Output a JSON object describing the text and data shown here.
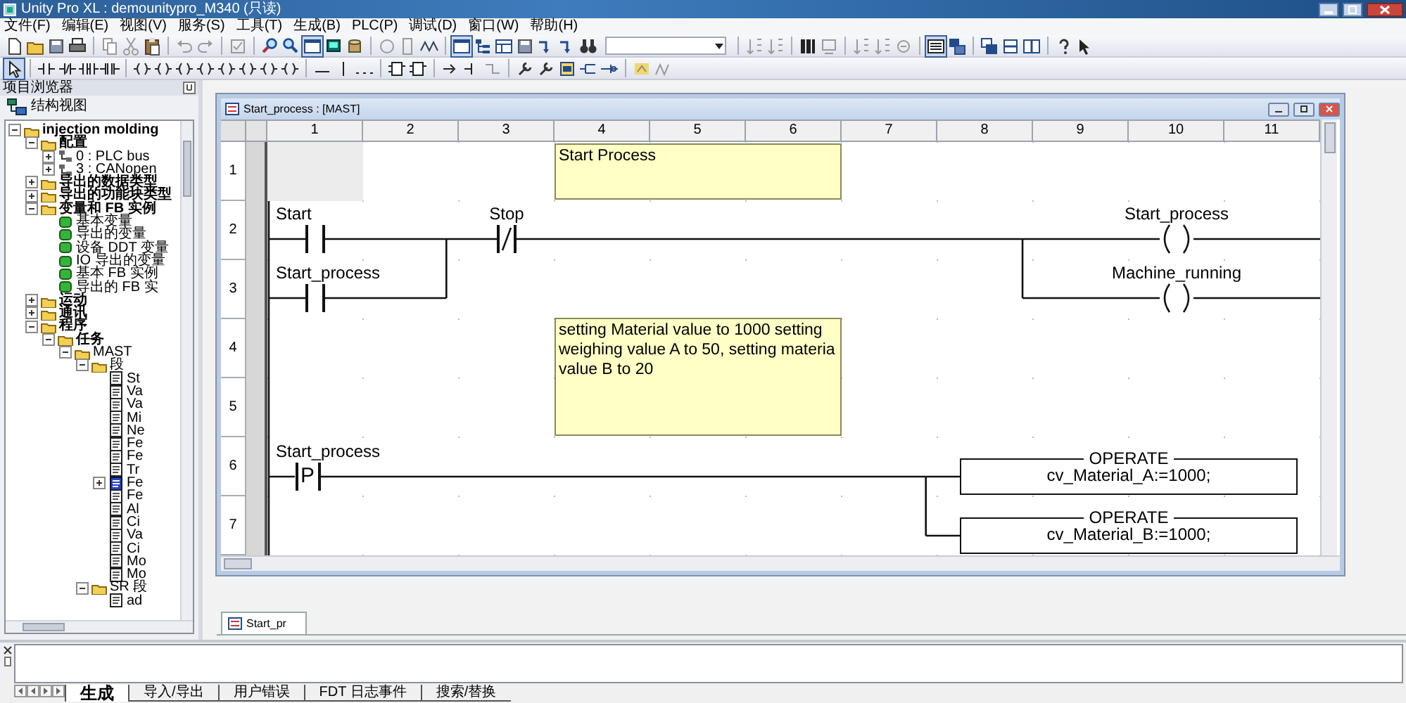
{
  "window": {
    "title": "Unity Pro XL : demounitypro_M340 (只读)"
  },
  "menu": [
    "文件(F)",
    "编辑(E)",
    "视图(V)",
    "服务(S)",
    "工具(T)",
    "生成(B)",
    "PLC(P)",
    "调试(D)",
    "窗口(W)",
    "帮助(H)"
  ],
  "project_browser": {
    "title": "项目浏览器",
    "view": "结构视图",
    "tree": [
      {
        "label": "injection molding",
        "kind": "folder",
        "expanded": true,
        "children": [
          {
            "label": "配置",
            "kind": "folder",
            "expanded": true,
            "children": [
              {
                "label": "0 : PLC bus",
                "kind": "bus",
                "expanded": false
              },
              {
                "label": "3 : CANopen",
                "kind": "bus",
                "expanded": false
              }
            ]
          },
          {
            "label": "导出的数据类型",
            "kind": "folder",
            "expanded": false
          },
          {
            "label": "导出的功能块类型",
            "kind": "folder",
            "expanded": false
          },
          {
            "label": "变量和 FB 实例",
            "kind": "folder",
            "expanded": true,
            "children": [
              {
                "label": "基本变量",
                "kind": "variable"
              },
              {
                "label": "导出的变量",
                "kind": "variable"
              },
              {
                "label": "设备 DDT 变量",
                "kind": "variable"
              },
              {
                "label": "IO 导出的变量",
                "kind": "variable"
              },
              {
                "label": "基本 FB 实例",
                "kind": "variable"
              },
              {
                "label": "导出的 FB 实",
                "kind": "variable"
              }
            ]
          },
          {
            "label": "运动",
            "kind": "folder",
            "expanded": false
          },
          {
            "label": "通讯",
            "kind": "folder",
            "expanded": false
          },
          {
            "label": "程序",
            "kind": "folder",
            "expanded": true,
            "children": [
              {
                "label": "任务",
                "kind": "folder",
                "expanded": true,
                "children": [
                  {
                    "label": "MAST",
                    "kind": "folder",
                    "expanded": true,
                    "children": [
                      {
                        "label": "段",
                        "kind": "folder",
                        "expanded": true,
                        "children": [
                          {
                            "label": "St",
                            "kind": "section"
                          },
                          {
                            "label": "Va",
                            "kind": "section"
                          },
                          {
                            "label": "Va",
                            "kind": "section"
                          },
                          {
                            "label": "Mi",
                            "kind": "section"
                          },
                          {
                            "label": "Ne",
                            "kind": "section"
                          },
                          {
                            "label": "Fe",
                            "kind": "section"
                          },
                          {
                            "label": "Fe",
                            "kind": "section"
                          },
                          {
                            "label": "Tr",
                            "kind": "section"
                          },
                          {
                            "label": "Fe",
                            "kind": "section_active",
                            "expanded": false
                          },
                          {
                            "label": "Fe",
                            "kind": "section"
                          },
                          {
                            "label": "Al",
                            "kind": "section"
                          },
                          {
                            "label": "Ci",
                            "kind": "section"
                          },
                          {
                            "label": "Va",
                            "kind": "section"
                          },
                          {
                            "label": "Ci",
                            "kind": "section"
                          },
                          {
                            "label": "Mo",
                            "kind": "section"
                          },
                          {
                            "label": "Mo",
                            "kind": "section"
                          }
                        ]
                      },
                      {
                        "label": "SR 段",
                        "kind": "folder",
                        "expanded": true,
                        "children": [
                          {
                            "label": "ad",
                            "kind": "section"
                          }
                        ]
                      }
                    ]
                  }
                ]
              }
            ]
          }
        ]
      }
    ]
  },
  "editor": {
    "title": "Start_process : [MAST]",
    "columns": [
      "1",
      "2",
      "3",
      "4",
      "5",
      "6",
      "7",
      "8",
      "9",
      "10",
      "11"
    ],
    "rows": [
      "1",
      "2",
      "3",
      "4",
      "5",
      "6",
      "7"
    ],
    "ladder": [
      {
        "kind": "comment",
        "lines": [
          "Start Process"
        ]
      },
      {
        "kind": "contact",
        "label": "Start"
      },
      {
        "kind": "contact_negated",
        "label": "Stop"
      },
      {
        "kind": "coil",
        "label": "Start_process"
      },
      {
        "kind": "contact",
        "label": "Start_process"
      },
      {
        "kind": "coil",
        "label": "Machine_running"
      },
      {
        "kind": "comment",
        "lines": [
          "setting Material value to 1000 setting",
          "weighing value A to 50, setting materia",
          "value B to 20"
        ]
      },
      {
        "kind": "contact_rising",
        "label": "Start_process",
        "symbol": "P"
      },
      {
        "kind": "operate",
        "title": "OPERATE",
        "expression": "cv_Material_A:=1000;"
      },
      {
        "kind": "operate",
        "title": "OPERATE",
        "expression": "cv_Material_B:=1000;"
      }
    ],
    "tab": "Start_pr"
  },
  "output": {
    "tabs": [
      {
        "label": "生成",
        "selected": true
      },
      {
        "label": "导入/导出",
        "selected": false
      },
      {
        "label": "用户错误",
        "selected": false
      },
      {
        "label": "FDT 日志事件",
        "selected": false
      },
      {
        "label": "搜索/替换",
        "selected": false
      }
    ]
  }
}
